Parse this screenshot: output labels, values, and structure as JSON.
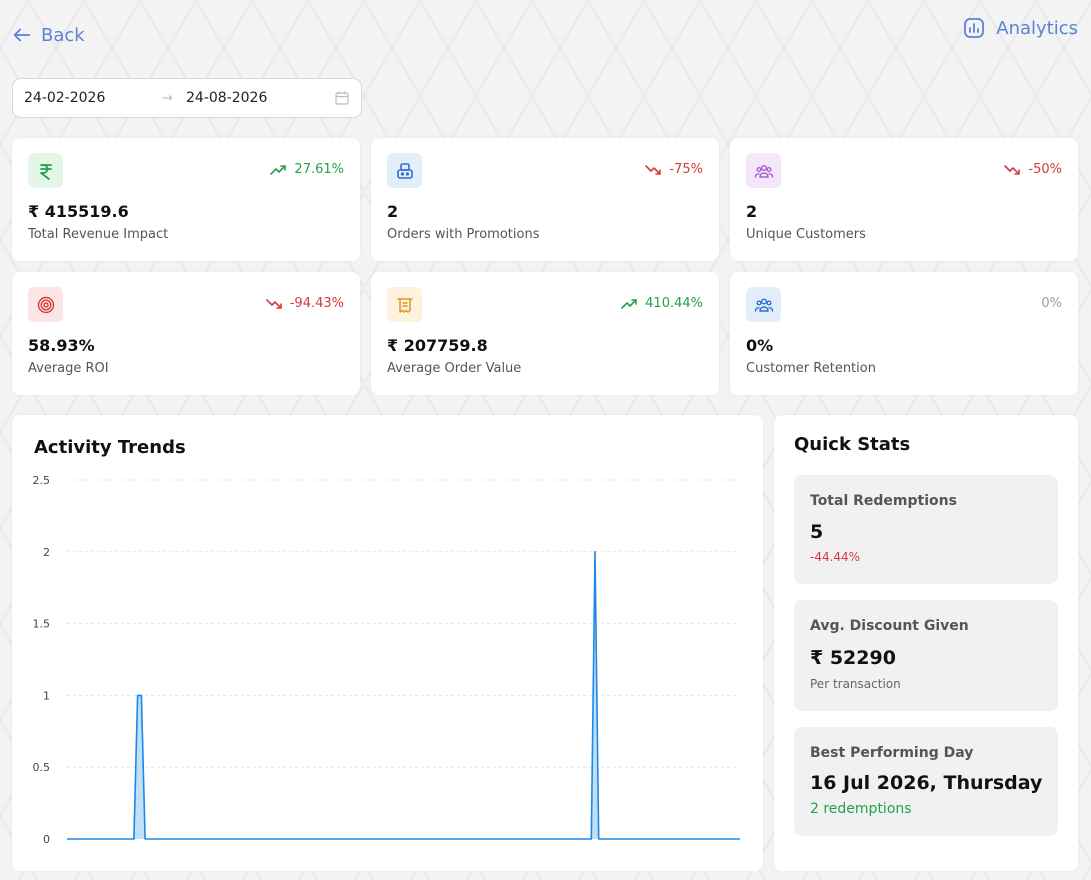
{
  "nav": {
    "back_label": "Back",
    "analytics_label": "Analytics"
  },
  "date_range": {
    "start": "24-02-2026",
    "end": "24-08-2026",
    "separator": "→"
  },
  "stats": [
    {
      "id": "revenue",
      "icon": "rupee-icon",
      "value": "₹ 415519.6",
      "label": "Total Revenue Impact",
      "change": "27.61%",
      "direction": "up"
    },
    {
      "id": "orders",
      "icon": "promotion-icon",
      "value": "2",
      "label": "Orders with Promotions",
      "change": "-75%",
      "direction": "down"
    },
    {
      "id": "customers",
      "icon": "users-icon",
      "value": "2",
      "label": "Unique Customers",
      "change": "-50%",
      "direction": "down"
    },
    {
      "id": "roi",
      "icon": "target-icon",
      "value": "58.93%",
      "label": "Average ROI",
      "change": "-94.43%",
      "direction": "down"
    },
    {
      "id": "aov",
      "icon": "receipt-icon",
      "value": "₹ 207759.8",
      "label": "Average Order Value",
      "change": "410.44%",
      "direction": "up"
    },
    {
      "id": "retention",
      "icon": "team-icon",
      "value": "0%",
      "label": "Customer Retention",
      "change": "0%",
      "direction": "flat"
    }
  ],
  "colors": {
    "up": "#24a148",
    "down": "#d63b3b",
    "flat": "#9aa0a6",
    "accent": "#5b82d6",
    "line": "#1e88e5",
    "fill": "#bfe0f7"
  },
  "activity": {
    "title": "Activity Trends",
    "chart_data": {
      "type": "area",
      "title": "Activity Trends",
      "xlabel": "",
      "ylabel": "",
      "ylim": [
        0,
        2.5
      ],
      "yticks": [
        "0",
        "0.5",
        "1",
        "1.5",
        "2",
        "2.5"
      ],
      "grid": true,
      "x_count": 182,
      "series": [
        {
          "points": [
            [
              0,
              0
            ],
            [
              18,
              0
            ],
            [
              19,
              1
            ],
            [
              20,
              1
            ],
            [
              21,
              0
            ],
            [
              141,
              0
            ],
            [
              142,
              2
            ],
            [
              143,
              0
            ],
            [
              181,
              0
            ]
          ]
        }
      ]
    }
  },
  "quick_stats": {
    "title": "Quick Stats",
    "redemptions": {
      "title": "Total Redemptions",
      "value": "5",
      "sub": "-44.44%"
    },
    "discount": {
      "title": "Avg. Discount Given",
      "value": "₹ 52290",
      "sub": "Per transaction"
    },
    "best_day": {
      "title": "Best Performing Day",
      "value": "16 Jul 2026, Thursday",
      "sub": "2 redemptions"
    }
  }
}
